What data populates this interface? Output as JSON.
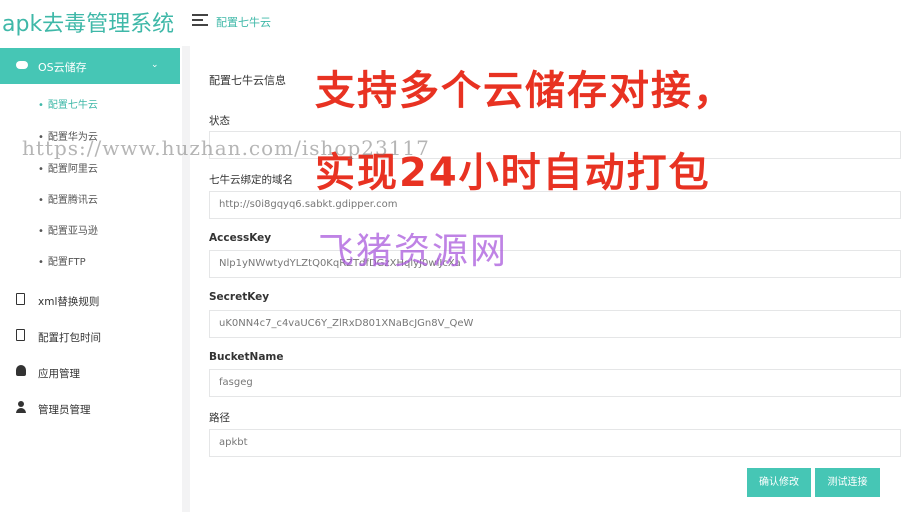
{
  "app": {
    "title": "apk去毒管理系统"
  },
  "header": {
    "breadcrumb": "配置七牛云"
  },
  "sidebar": {
    "active_group": "OS云储存",
    "subitems": [
      {
        "label": "配置七牛云",
        "active": true
      },
      {
        "label": "配置华为云",
        "active": false
      },
      {
        "label": "配置阿里云",
        "active": false
      },
      {
        "label": "配置腾讯云",
        "active": false
      },
      {
        "label": "配置亚马逊",
        "active": false
      },
      {
        "label": "配置FTP",
        "active": false
      }
    ],
    "items": [
      {
        "label": "xml替换规则",
        "icon": "clipboard-icon"
      },
      {
        "label": "配置打包时间",
        "icon": "clipboard-icon"
      },
      {
        "label": "应用管理",
        "icon": "android-icon"
      },
      {
        "label": "管理员管理",
        "icon": "user-icon"
      }
    ]
  },
  "form": {
    "title": "配置七牛云信息",
    "fields": [
      {
        "label": "状态",
        "value": ""
      },
      {
        "label": "七牛云绑定的域名",
        "value": "http://s0i8gqyq6.sabkt.gdipper.com"
      },
      {
        "label": "AccessKey",
        "value": "Nlp1yNWwtydYLZtQ0KqRZTdfDGzXHqlyJ0wlJcXa"
      },
      {
        "label": "SecretKey",
        "value": "uK0NN4c7_c4vaUC6Y_ZlRxD801XNaBcJGn8V_QeW"
      },
      {
        "label": "BucketName",
        "value": "fasgeg"
      },
      {
        "label": "路径",
        "value": "apkbt"
      }
    ],
    "confirm_label": "确认修改",
    "test_label": "测试连接"
  },
  "overlay": {
    "line1": "支持多个云储存对接，",
    "line2": "实现24小时自动打包",
    "watermark_url": "https://www.huzhan.com/ishop23117",
    "watermark_brand": "飞猪资源网"
  },
  "colors": {
    "accent": "#46c6b5",
    "overlay_red": "#e83222"
  }
}
